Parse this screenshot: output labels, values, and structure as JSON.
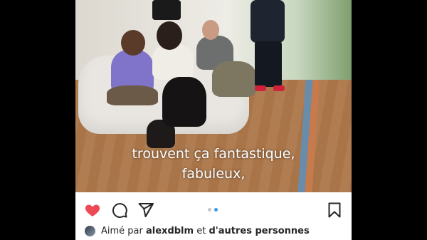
{
  "post": {
    "video": {
      "subtitle_line1": "trouvent ça fantastique,",
      "subtitle_line2": "fabuleux,"
    },
    "actions": {
      "like_icon": "heart-filled-icon",
      "comment_icon": "comment-icon",
      "share_icon": "send-icon",
      "save_icon": "bookmark-icon",
      "liked": true
    },
    "carousel": {
      "count": 2,
      "active_index": 1
    },
    "likes": {
      "prefix": "Aimé par",
      "user": "alexdblm",
      "connector": "et",
      "others": "d'autres personnes"
    }
  },
  "colors": {
    "heart": "#ed4956",
    "icon": "#262626",
    "dot_active": "#3897f0",
    "dot_inactive": "#c7c7c7"
  }
}
